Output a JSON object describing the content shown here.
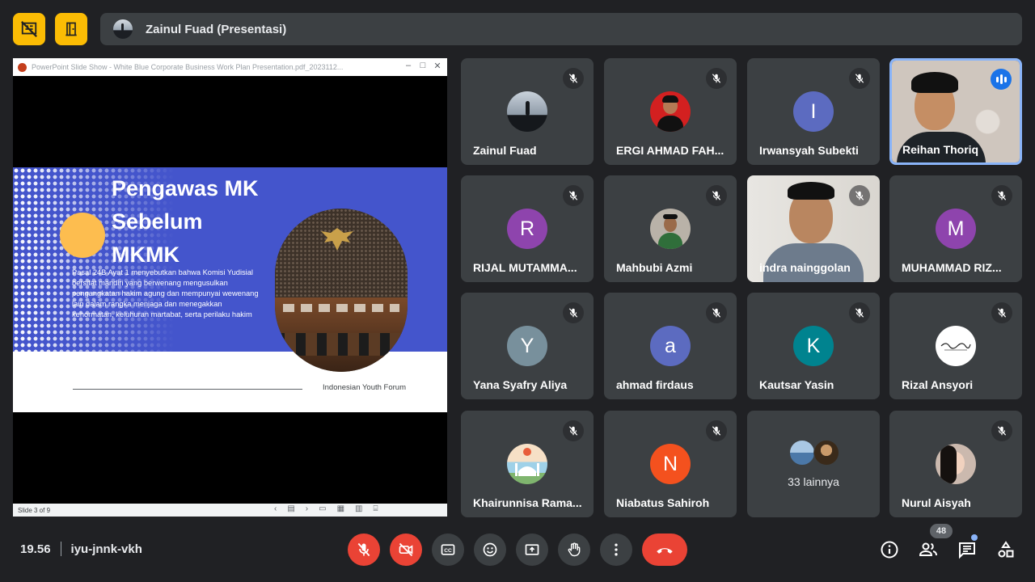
{
  "presenter_bar": {
    "text": "Zainul Fuad (Presentasi)"
  },
  "presentation": {
    "window_title": "PowerPoint Slide Show  -  White Blue Corporate Business Work Plan Presentation.pdf_2023112...",
    "slide": {
      "title_lines": [
        "Pengawas MK",
        "Sebelum",
        "MKMK"
      ],
      "body": "Pasal 24B Ayat 1 menyebutkan bahwa Komisi Yudisial bersifat mandiri yang berwenang mengusulkan pengangkatan hakim agung dan mempunyai wewenang lain dalam rangka menjaga dan menegakkan kehormatan, keluhuran martabat, serta perilaku hakim",
      "footer": "Indonesian Youth Forum"
    },
    "status": "Slide 3 of 9"
  },
  "participants": [
    {
      "name": "Zainul Fuad"
    },
    {
      "name": "ERGI AHMAD FAH..."
    },
    {
      "name": "Irwansyah Subekti",
      "initial": "I"
    },
    {
      "name": "Reihan Thoriq"
    },
    {
      "name": "RIJAL MUTAMMA...",
      "initial": "R"
    },
    {
      "name": "Mahbubi Azmi"
    },
    {
      "name": "indra nainggolan"
    },
    {
      "name": "MUHAMMAD RIZ...",
      "initial": "M"
    },
    {
      "name": "Yana Syafry Aliya",
      "initial": "Y"
    },
    {
      "name": "ahmad firdaus",
      "initial": "a"
    },
    {
      "name": "Kautsar Yasin",
      "initial": "K"
    },
    {
      "name": "Rizal Ansyori"
    },
    {
      "name": "Khairunnisa Rama..."
    },
    {
      "name": "Niabatus Sahiroh",
      "initial": "N"
    },
    {
      "name": "Nurul Aisyah"
    }
  ],
  "others_tile": {
    "label": "33 lainnya"
  },
  "bottom_bar": {
    "time": "19.56",
    "meeting_code": "iyu-jnnk-vkh",
    "participant_count": "48"
  },
  "colors": {
    "background": "#202124",
    "tile": "#3c4043",
    "accent_yellow": "#fbbc04",
    "danger_red": "#ea4335",
    "active_border": "#8ab4f8",
    "slide_blue": "#4455cc",
    "slide_sun": "#fdbd4f"
  },
  "icons": [
    "hide-tiles-icon",
    "door-icon",
    "mic-off-icon",
    "speaking-indicator-icon",
    "camera-off-icon",
    "captions-icon",
    "emoji-icon",
    "present-screen-icon",
    "raise-hand-icon",
    "more-options-icon",
    "hang-up-icon",
    "info-icon",
    "people-icon",
    "chat-icon",
    "activities-icon"
  ]
}
